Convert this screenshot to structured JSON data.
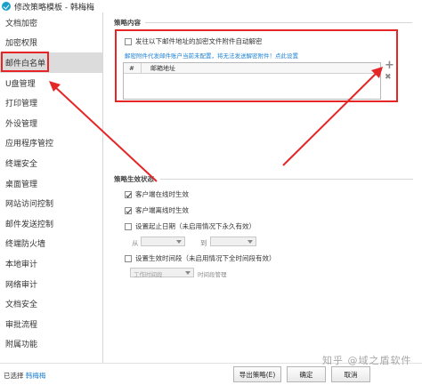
{
  "window": {
    "title": "修改策略模板 - 韩梅梅"
  },
  "sidebar": {
    "items": [
      {
        "label": "文档加密"
      },
      {
        "label": "加密权限"
      },
      {
        "label": "邮件白名单"
      },
      {
        "label": "U盘管理"
      },
      {
        "label": "打印管理"
      },
      {
        "label": "外设管理"
      },
      {
        "label": "应用程序管控"
      },
      {
        "label": "终端安全"
      },
      {
        "label": "桌面管理"
      },
      {
        "label": "网站访问控制"
      },
      {
        "label": "邮件发送控制"
      },
      {
        "label": "终端防火墙"
      },
      {
        "label": "本地审计"
      },
      {
        "label": "网络审计"
      },
      {
        "label": "文档安全"
      },
      {
        "label": "审批流程"
      },
      {
        "label": "附属功能"
      }
    ],
    "active_index": 2
  },
  "policy_content": {
    "section_title": "策略内容",
    "auto_decrypt_label": "发往以下邮件地址的加密文件附件自动解密",
    "note": "解密附件代发邮件账户当前未配置，将无法发送解密附件！点此设置",
    "table": {
      "columns": [
        "#",
        "邮箱地址"
      ]
    },
    "add_symbol": "+",
    "remove_symbol": "✖"
  },
  "policy_condition": {
    "section_title": "策略生效状态",
    "online_label": "客户端在线时生效",
    "online_checked": true,
    "offline_label": "客户端离线时生效",
    "offline_checked": true,
    "date_label": "设置起止日期（未启用情况下永久有效）",
    "from_label": "从",
    "to_label": "到",
    "time_label": "设置生效时间段（未启用情况下全时间段有效）",
    "time_select": "工作时间段",
    "time_manage": "时间段管理"
  },
  "footer": {
    "prefix": "已选择",
    "user": "韩梅梅",
    "export_button": "导出策略(E)",
    "ok_button": "确定",
    "cancel_button": "取消"
  },
  "watermark": "知乎 @域之盾软件",
  "colors": {
    "highlight": "#e52626",
    "link": "#1a7fd4"
  }
}
